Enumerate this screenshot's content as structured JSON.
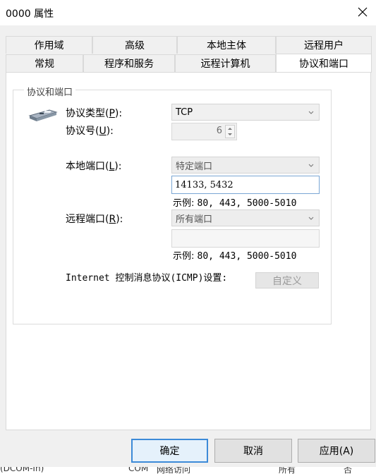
{
  "window": {
    "title": "0000 属性"
  },
  "tabs_back": [
    {
      "label": "作用域"
    },
    {
      "label": "高级"
    },
    {
      "label": "本地主体"
    },
    {
      "label": "远程用户"
    }
  ],
  "tabs_front": [
    {
      "label": "常规"
    },
    {
      "label": "程序和服务"
    },
    {
      "label": "远程计算机"
    },
    {
      "label": "协议和端口",
      "active": true
    }
  ],
  "group": {
    "title": "协议和端口",
    "protocol_type": {
      "label_pre": "协议类型(",
      "key": "P",
      "label_post": "):",
      "value": "TCP"
    },
    "protocol_number": {
      "label_pre": "协议号(",
      "key": "U",
      "label_post": "):",
      "value": "6"
    },
    "local_port": {
      "label_pre": "本地端口(",
      "key": "L",
      "label_post": "):",
      "select_value": "特定端口",
      "input_value": "14133, 5432",
      "example_prefix": "示例:",
      "example_values": "80, 443, 5000-5010"
    },
    "remote_port": {
      "label_pre": "远程端口(",
      "key": "R",
      "label_post": "):",
      "select_value": "所有端口",
      "input_value": "",
      "example_prefix": "示例:",
      "example_values": "80, 443, 5000-5010"
    },
    "icmp": {
      "label": "Internet 控制消息协议(ICMP)设置:",
      "button": "自定义"
    }
  },
  "buttons": {
    "ok": "确定",
    "cancel": "取消",
    "apply": "应用(A)"
  },
  "background_bleed": [
    "(DCOM-In)",
    "COM",
    "网络访问",
    "所有",
    "否"
  ],
  "icons": {
    "close": "close-icon",
    "network": "network-adapter-icon",
    "chevron": "chevron-down-icon"
  }
}
